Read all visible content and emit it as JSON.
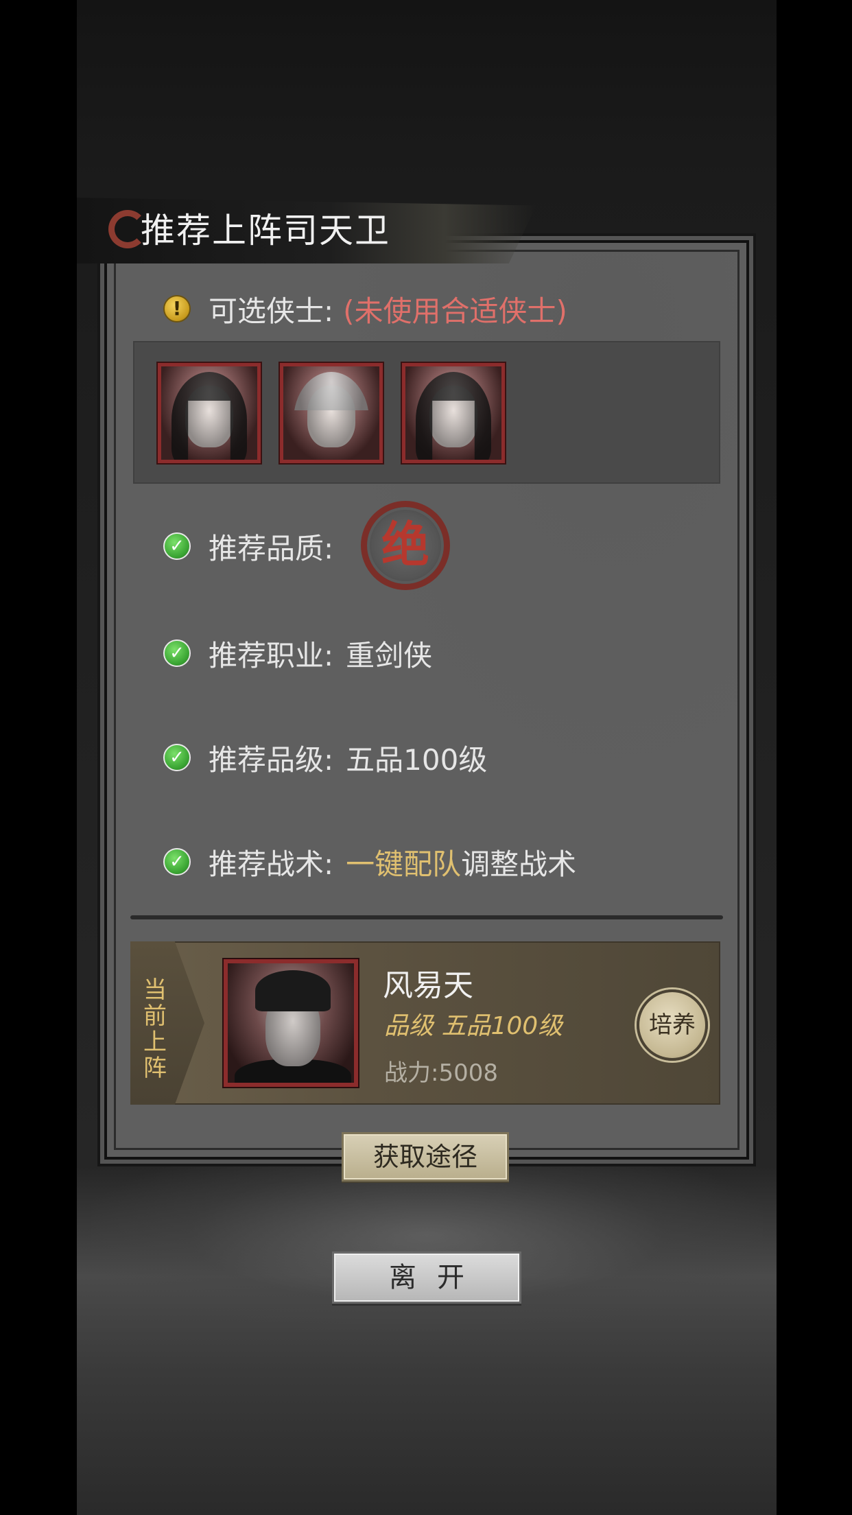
{
  "dialog": {
    "title": "推荐上阵司天卫"
  },
  "available": {
    "label": "可选侠士:",
    "status": "(未使用合适侠士)",
    "heroes": [
      {
        "name": "hero-portrait-1"
      },
      {
        "name": "hero-portrait-2"
      },
      {
        "name": "hero-portrait-3"
      }
    ]
  },
  "recommend": {
    "quality_label": "推荐品质:",
    "quality_seal": "绝",
    "job_label": "推荐职业:",
    "job_value": "重剑侠",
    "grade_label": "推荐品级:",
    "grade_value": "五品100级",
    "tactic_label": "推荐战术:",
    "tactic_link": "一键配队",
    "tactic_value": "调整战术"
  },
  "current": {
    "tag": "当前上阵",
    "name": "风易天",
    "rank": "品级 五品100级",
    "power": "战力:5008",
    "train_button": "培养"
  },
  "buttons": {
    "acquire": "获取途径",
    "leave": "离开"
  },
  "colors": {
    "warning_text": "#e0706a",
    "gold_text": "#e0c070",
    "portrait_border": "#8c2c2c"
  }
}
